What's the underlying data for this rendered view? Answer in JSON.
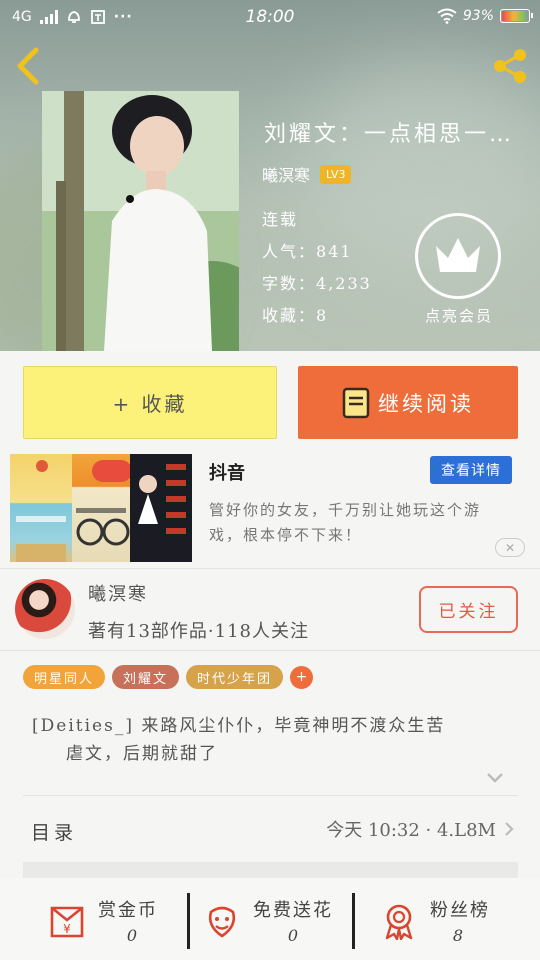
{
  "status_bar": {
    "network": "4G",
    "time": "18:00",
    "battery": "93%"
  },
  "book": {
    "title": "刘耀文：一点相思一…",
    "author": "曦溟寒",
    "level": "LV3",
    "status": "连载",
    "popularity_label": "人气：",
    "popularity": "841",
    "word_count_label": "字数：",
    "word_count": "4,233",
    "favorites_label": "收藏：",
    "favorites": "8",
    "vip_label": "点亮会员"
  },
  "actions": {
    "collect_label": "+ 收藏",
    "read_label": "继续阅读"
  },
  "ad": {
    "app_name": "抖音",
    "detail_button": "查看详情",
    "description": "管好你的女友，千万别让她玩这个游戏，根本停不下来！"
  },
  "author": {
    "name": "曦溟寒",
    "stats": "著有13部作品·118人关注",
    "follow_label": "已关注"
  },
  "tags": [
    {
      "label": "明星同人",
      "color": "#f0a43a"
    },
    {
      "label": "刘耀文",
      "color": "#c7705a"
    },
    {
      "label": "时代少年团",
      "color": "#d6a24a"
    }
  ],
  "synopsis": {
    "line1": "[Deities_] 来路风尘仆仆，毕竟神明不渡众生苦",
    "line2": "虐文，后期就甜了"
  },
  "toc": {
    "label": "目录",
    "info": "今天 10:32 · 4.L8M"
  },
  "bottom_bar": {
    "items": [
      {
        "label": "赏金币",
        "count": "0",
        "icon": "coin-envelope-icon"
      },
      {
        "label": "免费送花",
        "count": "0",
        "icon": "flower-icon"
      },
      {
        "label": "粉丝榜",
        "count": "8",
        "icon": "ribbon-medal-icon"
      }
    ]
  },
  "colors": {
    "accent_orange": "#ef6d3b",
    "collect_yellow": "#fcf27a",
    "ad_blue": "#2c6fd6",
    "follow_red": "#e25a45"
  }
}
